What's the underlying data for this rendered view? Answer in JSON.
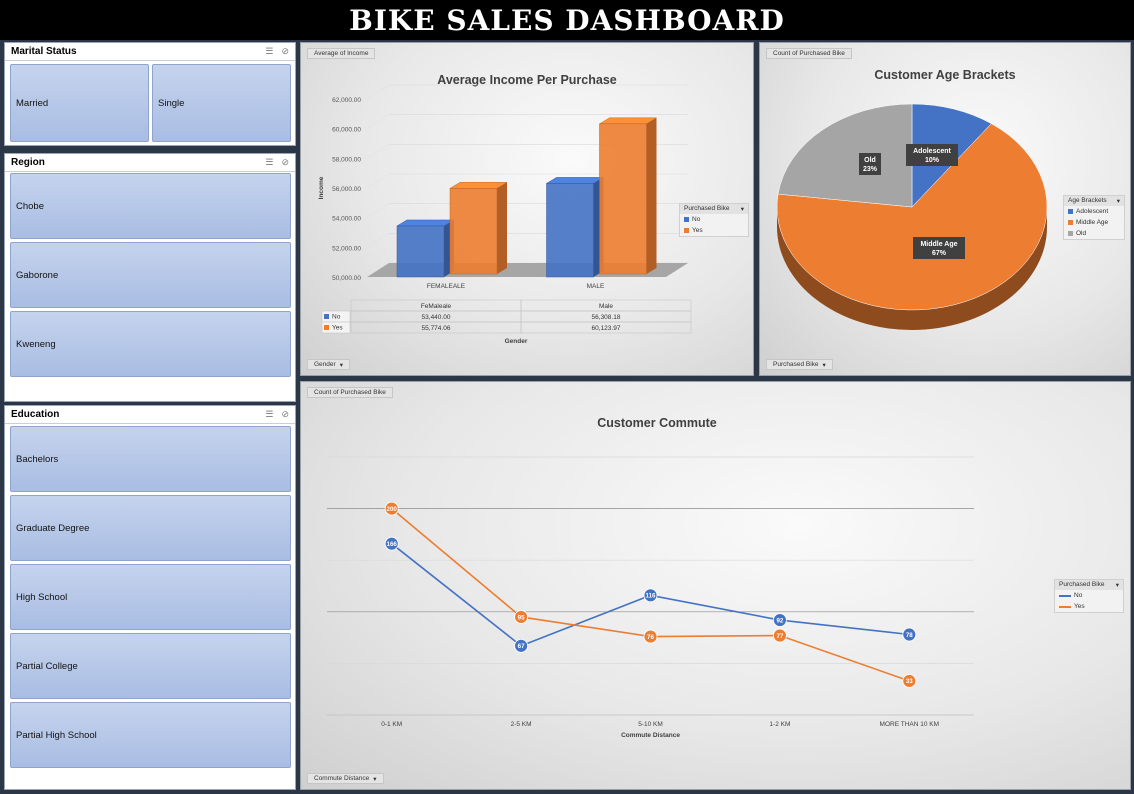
{
  "dashboard": {
    "title": "BIKE SALES DASHBOARD"
  },
  "slicers": {
    "marital": {
      "title": "Marital Status",
      "items": [
        "Married",
        "Single"
      ]
    },
    "region": {
      "title": "Region",
      "items": [
        "Chobe",
        "Gaborone",
        "Kweneng"
      ]
    },
    "education": {
      "title": "Education",
      "items": [
        "Bachelors",
        "Graduate Degree",
        "High School",
        "Partial College",
        "Partial High School"
      ]
    }
  },
  "panels": {
    "income": {
      "field_label": "Average of Income",
      "axis_button": "Gender",
      "table_header": [
        "FeMaleale",
        "Male"
      ],
      "table_rows": [
        [
          "No",
          "53,440.00",
          "56,308.18"
        ],
        [
          "Yes",
          "55,774.06",
          "60,123.97"
        ]
      ]
    },
    "age": {
      "field_label": "Count of Purchased Bike",
      "axis_button": "Purchased Bike"
    },
    "commute": {
      "field_label": "Count of Purchased Bike",
      "axis_button": "Commute Distance"
    }
  },
  "colors": {
    "no": "#4472c4",
    "yes": "#ed7d31",
    "old": "#a5a5a5"
  },
  "chart_data": [
    {
      "type": "bar",
      "title": "Average Income Per Purchase",
      "xlabel": "Gender",
      "ylabel": "Income",
      "categories": [
        "FEMALEALE",
        "MALE"
      ],
      "series": [
        {
          "name": "No",
          "values": [
            53440.0,
            56308.18
          ]
        },
        {
          "name": "Yes",
          "values": [
            55774.06,
            60123.97
          ]
        }
      ],
      "ylim": [
        50000,
        62000
      ],
      "yticks": [
        "50,000.00",
        "52,000.00",
        "54,000.00",
        "56,000.00",
        "58,000.00",
        "60,000.00",
        "62,000.00"
      ],
      "legend_title": "Purchased Bike",
      "legend": "right"
    },
    {
      "type": "pie",
      "title": "Customer Age Brackets",
      "slices": [
        {
          "name": "Adolescent",
          "value": 10,
          "label": "Adolescent 10%"
        },
        {
          "name": "Middle Age",
          "value": 67,
          "label": "Middle Age 67%"
        },
        {
          "name": "Old",
          "value": 23,
          "label": "Old 23%"
        }
      ],
      "legend_title": "Age Brackets",
      "legend": "right"
    },
    {
      "type": "line",
      "title": "Customer Commute",
      "xlabel": "Commute Distance",
      "categories": [
        "0-1 KM",
        "2-5 KM",
        "5-10 KM",
        "1-2 KM",
        "MORE THAN 10 KM"
      ],
      "series": [
        {
          "name": "No",
          "values": [
            166,
            67,
            116,
            92,
            78
          ]
        },
        {
          "name": "Yes",
          "values": [
            200,
            95,
            76,
            77,
            33
          ]
        }
      ],
      "ylim": [
        0,
        250
      ],
      "legend_title": "Purchased Bike",
      "legend": "right"
    }
  ]
}
